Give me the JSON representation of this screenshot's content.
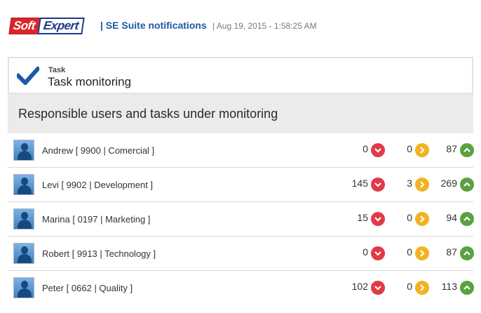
{
  "header": {
    "logo_left": "Soft",
    "logo_right": "Expert",
    "title": "| SE Suite notifications",
    "date": "| Aug 19, 2015 - 1:58:25 AM"
  },
  "task": {
    "label": "Task",
    "value": "Task monitoring"
  },
  "section": {
    "title": "Responsible users and tasks under monitoring"
  },
  "colors": {
    "late": "#e03a48",
    "warning": "#f2b221",
    "on_time": "#5aa13f",
    "brand_blue": "#1b5aa6",
    "brand_red": "#d9252b"
  },
  "rows": [
    {
      "name": "Andrew [ 9900 | Comercial ]",
      "late": "0",
      "warning": "0",
      "on_time": "87"
    },
    {
      "name": "Levi [ 9902 | Development ]",
      "late": "145",
      "warning": "3",
      "on_time": "269"
    },
    {
      "name": "Marina [ 0197 | Marketing ]",
      "late": "15",
      "warning": "0",
      "on_time": "94"
    },
    {
      "name": "Robert [ 9913 | Technology ]",
      "late": "0",
      "warning": "0",
      "on_time": "87"
    },
    {
      "name": "Peter [ 0662 | Quality ]",
      "late": "102",
      "warning": "0",
      "on_time": "113"
    }
  ]
}
